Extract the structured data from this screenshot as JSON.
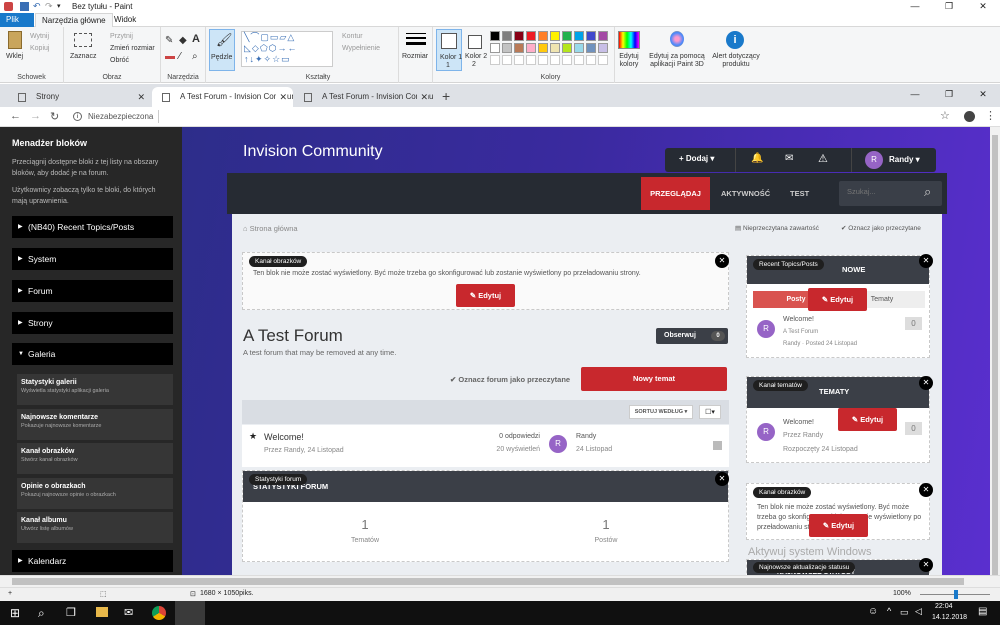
{
  "paint": {
    "title": "Bez tytułu - Paint",
    "tabs": [
      "Plik",
      "Narzędzia główne",
      "Widok"
    ],
    "ribbon": {
      "paste": "Wklej",
      "cut": "Wytnij",
      "copy": "Kopiuj",
      "clipboard": "Schowek",
      "select": "Zaznacz",
      "crop": "Przytnij",
      "resize": "Zmień rozmiar",
      "rotate": "Obróć",
      "image": "Obraz",
      "tools": "Narzędzia",
      "brushes": "Pędzle",
      "outline": "Kontur",
      "fill": "Wypełnienie",
      "shapes": "Kształty",
      "size": "Rozmiar",
      "color1": "Kolor 1",
      "color2": "Kolor 2",
      "colors": "Kolory",
      "edit_colors": "Edytuj kolory",
      "paint3d": "Edytuj za pomocą aplikacji Paint 3D",
      "alert": "Alert dotyczący produktu"
    },
    "palette": [
      "#000000",
      "#7f7f7f",
      "#880015",
      "#ed1c24",
      "#ff7f27",
      "#fff200",
      "#22b14c",
      "#00a2e8",
      "#3f48cc",
      "#a349a4",
      "#ffffff",
      "#c3c3c3",
      "#b97a57",
      "#ffaec9",
      "#ffc90e",
      "#efe4b0",
      "#b5e61d",
      "#99d9ea",
      "#7092be",
      "#c8bfe7"
    ],
    "status_size": "1680 × 1050piks.",
    "zoom": "100%"
  },
  "browser": {
    "tabs": [
      "Strony",
      "A Test Forum - Invision Communi",
      "A Test Forum - Invision Commu"
    ],
    "address": "Niezabezpieczona"
  },
  "sidebar": {
    "title": "Menadżer bloków",
    "desc1": "Przeciągnij dostępne bloki z tej listy na obszary bloków, aby dodać je na forum.",
    "desc2": "Użytkownicy zobaczą tylko te bloki, do których mają uprawnienia.",
    "items": [
      "(NB40) Recent Topics/Posts",
      "System",
      "Forum",
      "Strony",
      "Galeria"
    ],
    "gallery": [
      {
        "t": "Statystyki galerii",
        "d": "Wyświetla statystyki aplikacji galeria"
      },
      {
        "t": "Najnowsze komentarze",
        "d": "Pokazuje najnowsze komentarze"
      },
      {
        "t": "Kanał obrazków",
        "d": "Stwórz kanał obrazków"
      },
      {
        "t": "Opinie o obrazkach",
        "d": "Pokazuj najnowsze opinie o obrazkach"
      },
      {
        "t": "Kanał albumu",
        "d": "Utwórz listę albumów"
      }
    ],
    "last": "Kalendarz"
  },
  "site": {
    "brand": "Invision Community",
    "user_menu": {
      "add": "Dodaj",
      "user": "Randy",
      "initial": "R"
    },
    "nav": [
      "PRZEGLĄDAJ",
      "AKTYWNOŚĆ",
      "TEST"
    ],
    "search_placeholder": "Szukaj...",
    "breadcrumb": "Strona główna",
    "unread": "Nieprzeczytana zawartość",
    "mark_read": "Oznacz jako przeczytane",
    "image_feed": {
      "pill": "Kanał obrazków",
      "msg": "Ten blok nie może zostać wyświetlony. Być może trzeba go skonfigurować lub zostanie wyświetlony po przeładowaniu strony.",
      "edit": "Edytuj"
    },
    "forum": {
      "title": "A Test Forum",
      "desc": "A test forum that may be removed at any time.",
      "follow": "Obserwuj",
      "follow_count": "0",
      "mark": "Oznacz forum jako przeczytane",
      "new_topic": "Nowy temat",
      "sort": "SORTUJ WEDŁUG"
    },
    "topic": {
      "title": "Welcome!",
      "by": "Przez Randy, 24 Listopad",
      "replies": "0 odpowiedzi",
      "views": "20 wyświetleń",
      "last_user": "Randy",
      "last_date": "24 Listopad"
    },
    "stats": {
      "pill": "Statystyki forum",
      "head": "STATYSTYKI FORUM",
      "topics_num": "1",
      "topics_lbl": "Tematów",
      "posts_num": "1",
      "posts_lbl": "Postów"
    },
    "right": {
      "recent_pill": "Recent Topics/Posts",
      "recent_head": "NOWE",
      "posts_tab": "Posty",
      "topics_tab": "Tematy",
      "recent_item": {
        "title": "Welcome!",
        "forum": "A Test Forum",
        "meta": "Randy · Posted 24 Listopad",
        "count": "0"
      },
      "topics_pill": "Kanał tematów",
      "topics_head": "TEMATY",
      "topics_item": {
        "title": "Welcome!",
        "by": "Przez Randy",
        "date": "Rozpoczęty 24 Listopad",
        "count": "0"
      },
      "img_pill": "Kanał obrazków",
      "img_msg": "Ten blok nie może zostać wyświetlony. Być może trzeba go skonfigurować lub zostanie wyświetlony po przeładowaniu strony.",
      "status_pill": "Najnowsze aktualizacje statusu",
      "status_head": "NAJNOWSZE STATUSY",
      "edit": "Edytuj",
      "activate": "Aktywuj system Windows"
    }
  },
  "taskbar": {
    "time": "22:04",
    "date": "14.12.2018"
  }
}
